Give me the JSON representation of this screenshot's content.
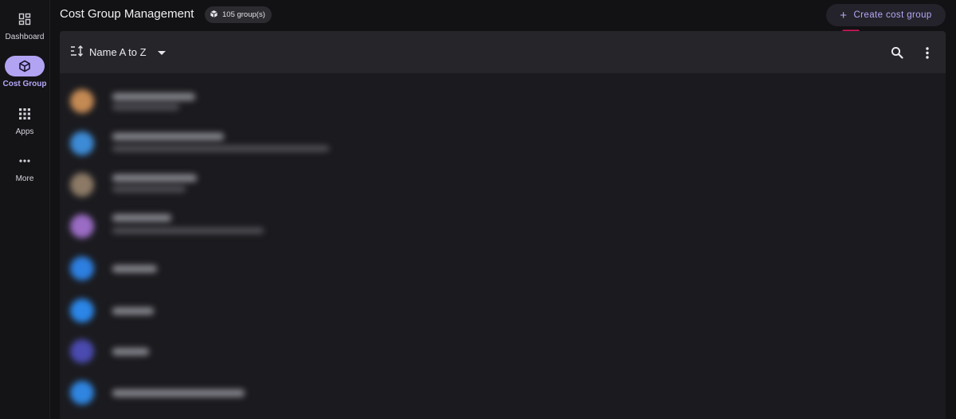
{
  "sidebar": {
    "items": [
      {
        "label": "Dashboard",
        "icon": "dashboard-icon",
        "active": false
      },
      {
        "label": "Cost Group",
        "icon": "cube-icon",
        "active": true
      },
      {
        "label": "Apps",
        "icon": "apps-grid-icon",
        "active": false
      },
      {
        "label": "More",
        "icon": "more-horizontal-icon",
        "active": false
      }
    ]
  },
  "header": {
    "title": "Cost Group Management",
    "group_count": "105 group(s)",
    "create_button_label": "Create cost group"
  },
  "toolbar": {
    "sort_label": "Name A to Z",
    "icons": [
      "sort-icon",
      "dropdown-arrow-icon",
      "search-icon",
      "more-vertical-icon"
    ]
  },
  "colors": {
    "accent": "#b7a7f7",
    "annotation": "#d4145a",
    "background": "#121215",
    "panel": "#1b1b1f"
  },
  "list_items": [
    {
      "avatar_color": "#c48a54"
    },
    {
      "avatar_color": "#3d8bd6"
    },
    {
      "avatar_color": "#8c7a66"
    },
    {
      "avatar_color": "#9a6cc4"
    },
    {
      "avatar_color": "#2d7fe0"
    },
    {
      "avatar_color": "#2b86e8"
    },
    {
      "avatar_color": "#4a4ab0"
    },
    {
      "avatar_color": "#2f85e0"
    }
  ]
}
